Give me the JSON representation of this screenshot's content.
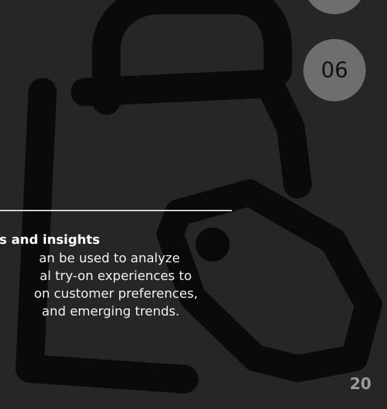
{
  "slide": {
    "heading": "s and insights",
    "body_lines": [
      "an be used to analyze",
      "al try-on experiences to",
      " on customer preferences,",
      " and emerging trends."
    ],
    "badge_number": "06",
    "page_number": "20"
  },
  "icons": {
    "background": "shopping-bag-with-tag-icon"
  },
  "colors": {
    "background": "#262626",
    "icon_stroke": "#0a0a0a",
    "badge": "#6e6e6e",
    "rule": "#d8d8d8",
    "text": "#ffffff"
  }
}
